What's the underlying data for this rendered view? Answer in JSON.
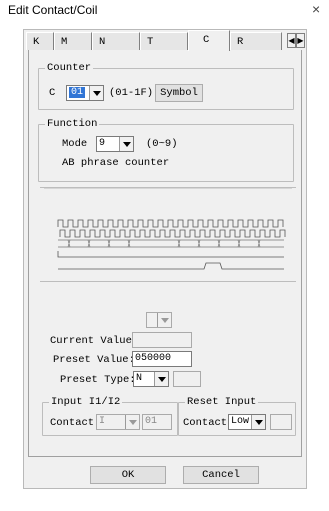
{
  "window": {
    "title": "Edit Contact/Coil",
    "close_glyph": "×"
  },
  "tabs": [
    {
      "label": "K",
      "active": false
    },
    {
      "label": "M",
      "active": false
    },
    {
      "label": "N",
      "active": false
    },
    {
      "label": "T",
      "active": false
    },
    {
      "label": "C",
      "active": true
    },
    {
      "label": "R",
      "active": false
    }
  ],
  "tab_scroll": {
    "left_icon": "arrow-left-icon",
    "right_icon": "arrow-right-icon"
  },
  "counter": {
    "legend": "Counter",
    "prefix": "C",
    "selected": "01",
    "range": "(01-1F)",
    "symbol_button": "Symbol"
  },
  "function": {
    "legend": "Function",
    "mode_label": "Mode",
    "mode_value": "9",
    "mode_range": "(0~9)",
    "description": "AB phrase counter"
  },
  "values": {
    "top_select": "",
    "current_label": "Current Value:",
    "current_value": "",
    "preset_label": "Preset Value:",
    "preset_value": "050000",
    "preset_type_label": "Preset Type:",
    "preset_type_value": "N",
    "preset_type_extra": ""
  },
  "input_group": {
    "legend": "Input I1/I2",
    "contact_label": "Contact",
    "contact_select": "I",
    "contact_number": "01"
  },
  "reset_group": {
    "legend": "Reset Input",
    "contact_label": "Contact",
    "contact_select": "Low",
    "contact_extra": ""
  },
  "buttons": {
    "ok": "OK",
    "cancel": "Cancel"
  },
  "colors": {
    "selection": "#3276d6",
    "dialog_bg": "#f0f0f0"
  }
}
